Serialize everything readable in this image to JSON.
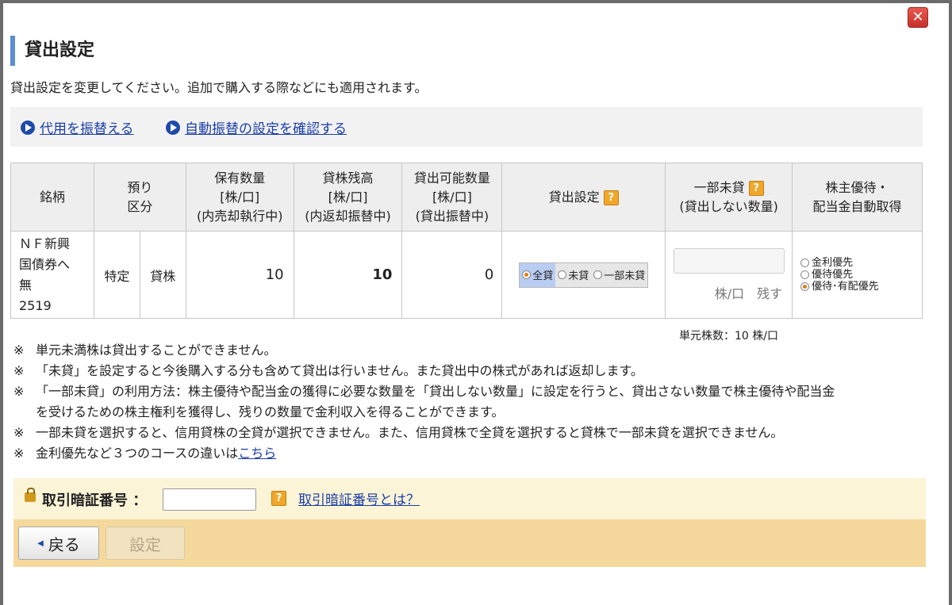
{
  "title": "貸出設定",
  "description": "貸出設定を変更してください。追加で購入する際などにも適用されます。",
  "links": [
    {
      "label": "代用を振替える"
    },
    {
      "label": "自動振替の設定を確認する"
    }
  ],
  "table": {
    "headers": {
      "stock": "銘柄",
      "deposit_1": "預り",
      "deposit_2": "区分",
      "holding_1": "保有数量",
      "holding_2": "[株/口]",
      "holding_3": "(内売却執行中)",
      "lending_1": "貸株残高",
      "lending_2": "[株/口]",
      "lending_3": "(内返却振替中)",
      "available_1": "貸出可能数量",
      "available_2": "[株/口]",
      "available_3": "(貸出振替中)",
      "setting": "貸出設定",
      "partial_1": "一部未貸",
      "partial_2": "(貸出しない数量)",
      "benefit_1": "株主優待・",
      "benefit_2": "配当金自動取得"
    },
    "row": {
      "name_1": "ＮＦ新興",
      "name_2": "国債券へ",
      "name_3": "無",
      "code": "2519",
      "account": "特定",
      "category": "貸株",
      "holding": "10",
      "lending": "10",
      "available": "0",
      "options": [
        {
          "label": "全貸",
          "selected": true
        },
        {
          "label": "未貸",
          "selected": false
        },
        {
          "label": "一部未貸",
          "selected": false
        }
      ],
      "partial_value": "",
      "partial_unit": "株/口　残す",
      "benefit_options": [
        {
          "label": "金利優先",
          "selected": false
        },
        {
          "label": "優待優先",
          "selected": false
        },
        {
          "label": "優待･有配優先",
          "selected": true
        }
      ]
    }
  },
  "unit_note": "単元株数：10 株/口",
  "notes": [
    "単元未満株は貸出することができません。",
    "「未貸」を設定すると今後購入する分も含めて貸出は行いません。また貸出中の株式があれば返却します。",
    "「一部未貸」の利用方法：株主優待や配当金の獲得に必要な数量を「貸出しない数量」に設定を行うと、貸出さない数量で株主優待や配当金",
    "を受けるための株主権利を獲得し、残りの数量で金利収入を得ることができます。",
    "一部未貸を選択すると、信用貸株の全貸が選択できません。また、信用貸株で全貸を選択すると貸株で一部未貸を選択できません。",
    "金利優先など３つのコースの違いは"
  ],
  "note_mark": "※",
  "note_link": "こちら",
  "pin": {
    "label": "取引暗証番号 ：",
    "value": "",
    "help_link": "取引暗証番号とは？"
  },
  "buttons": {
    "back": "戻る",
    "set": "設定"
  },
  "close_glyph": "✕",
  "help_glyph": "?",
  "colors": {
    "accent": "#5a8fd3",
    "link": "#1a3fa6",
    "close": "#d9443b",
    "action_bar": "#f5d99c",
    "pin_bar": "#fbf4d6"
  }
}
